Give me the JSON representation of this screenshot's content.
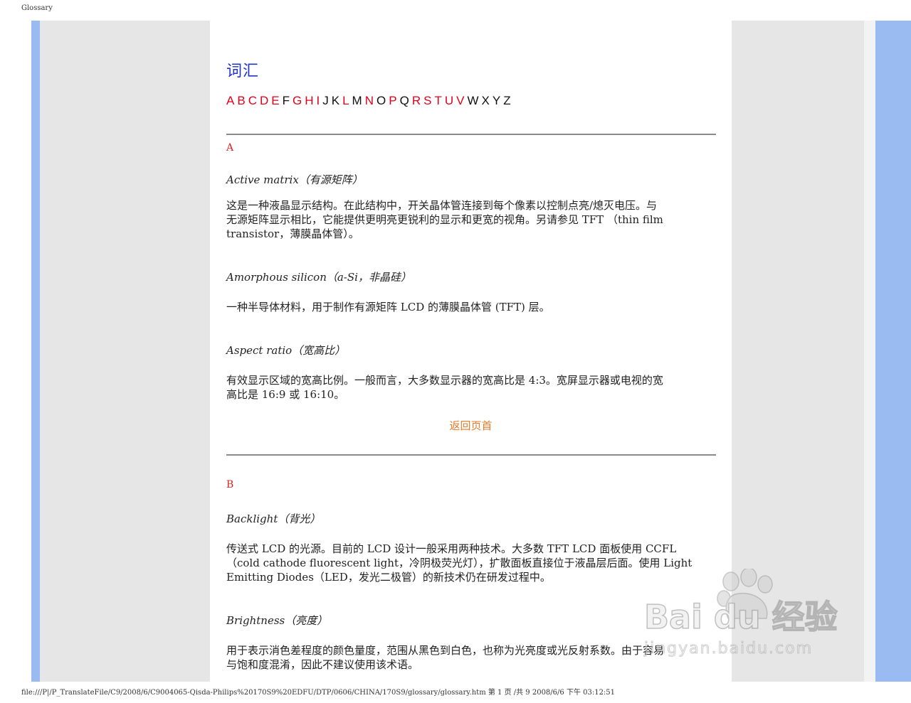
{
  "header": {
    "page_title": "Glossary"
  },
  "footer": {
    "text": "file:///P|/P_TranslateFile/C9/2008/6/C9004065-Qisda-Philips%20170S9%20EDFU/DTP/0606/CHINA/170S9/glossary/glossary.htm 第 1 页 /共 9 2008/6/6 下午 03:12:51"
  },
  "title": "词汇",
  "alphabet": [
    {
      "letter": "A",
      "link": true
    },
    {
      "letter": "B",
      "link": true
    },
    {
      "letter": "C",
      "link": true
    },
    {
      "letter": "D",
      "link": true
    },
    {
      "letter": "E",
      "link": true
    },
    {
      "letter": "F",
      "link": false
    },
    {
      "letter": "G",
      "link": true
    },
    {
      "letter": "H",
      "link": true
    },
    {
      "letter": "I",
      "link": true
    },
    {
      "letter": "J",
      "link": false
    },
    {
      "letter": "K",
      "link": false
    },
    {
      "letter": "L",
      "link": true
    },
    {
      "letter": "M",
      "link": false
    },
    {
      "letter": "N",
      "link": true
    },
    {
      "letter": "O",
      "link": false
    },
    {
      "letter": "P",
      "link": true
    },
    {
      "letter": "Q",
      "link": false
    },
    {
      "letter": "R",
      "link": true
    },
    {
      "letter": "S",
      "link": true
    },
    {
      "letter": "T",
      "link": true
    },
    {
      "letter": "U",
      "link": true
    },
    {
      "letter": "V",
      "link": true
    },
    {
      "letter": "W",
      "link": false
    },
    {
      "letter": "X",
      "link": false
    },
    {
      "letter": "Y",
      "link": false
    },
    {
      "letter": "Z",
      "link": false
    }
  ],
  "section_a": {
    "letter": "A",
    "entries": [
      {
        "term": "Active matrix（有源矩阵）",
        "lines": [
          "这是一种液晶显示结构。在此结构中，开关晶体管连接到每个像素以控制点亮/熄灭电压。与",
          "无源矩阵显示相比，它能提供更明亮更锐利的显示和更宽的视角。另请参见 TFT （thin film",
          "transistor，薄膜晶体管）。"
        ]
      },
      {
        "term": "Amorphous silicon（a-Si，非晶硅）",
        "lines": [
          "一种半导体材料，用于制作有源矩阵 LCD 的薄膜晶体管 (TFT) 层。"
        ]
      },
      {
        "term": "Aspect ratio（宽高比）",
        "lines": [
          "有效显示区域的宽高比例。一般而言，大多数显示器的宽高比是 4:3。宽屏显示器或电视的宽",
          "高比是 16:9 或 16:10。"
        ]
      }
    ]
  },
  "back_to_top": "返回页首",
  "section_b": {
    "letter": "B",
    "entries": [
      {
        "term": "Backlight（背光）",
        "lines": [
          "传送式 LCD 的光源。目前的 LCD 设计一般采用两种技术。大多数 TFT LCD 面板使用 CCFL",
          "（cold cathode fluorescent light，冷阴极荧光灯），扩散面板直接位于液晶层后面。使用 Light",
          "Emitting Diodes（LED，发光二极管）的新技术仍在研发过程中。"
        ]
      },
      {
        "term": "Brightness（亮度）",
        "lines": [
          "用于表示消色差程度的颜色量度，范围从黑色到白色，也称为光亮度或光反射系数。由于容易",
          "与饱和度混淆，因此不建议使用该术语。"
        ]
      }
    ]
  },
  "watermark": {
    "brand": "Bai du 经验",
    "url": "jingyan.baidu.com"
  }
}
